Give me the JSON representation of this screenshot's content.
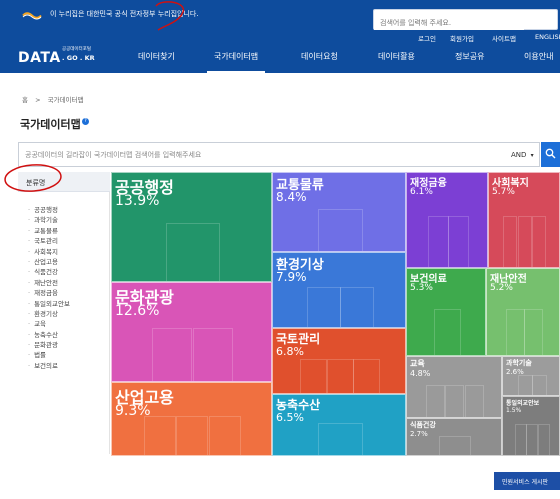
{
  "gov_banner": {
    "text": "이 누리집은 대한민국 공식 전자정부 누리집입니다."
  },
  "top_search": {
    "placeholder": "검색어를 입력해 주세요."
  },
  "util_links": [
    "로그인",
    "회원가입",
    "사이트맵",
    "ENGLISH"
  ],
  "brand": {
    "name": "DATA",
    "domain": ". GO . KR",
    "tagline": "공공데이터포털"
  },
  "nav": [
    "데이터찾기",
    "국가데이터맵",
    "데이터요청",
    "데이터활용",
    "정보공유",
    "이용안내"
  ],
  "breadcrumb": {
    "home": "홈",
    "separator": ">",
    "current": "국가데이터맵"
  },
  "page_title": "국가데이터맵",
  "map_search": {
    "placeholder": "공공데이터의 길라잡이 국가데이터맵 검색어를 입력해주세요",
    "operator": "AND"
  },
  "categories": {
    "header": "분류명",
    "items": [
      "공공행정",
      "과학기술",
      "교통물류",
      "국토관리",
      "사회복지",
      "산업고용",
      "식품건강",
      "재난안전",
      "재정금융",
      "통일외교안보",
      "환경기상",
      "교육",
      "농축수산",
      "문화관광",
      "법률",
      "보건의료"
    ]
  },
  "treemap": [
    {
      "name": "공공행정",
      "pct": "13.9%",
      "color": "#22956a"
    },
    {
      "name": "문화관광",
      "pct": "12.6%",
      "color": "#d955b7"
    },
    {
      "name": "산업고용",
      "pct": "9.3%",
      "color": "#f07040"
    },
    {
      "name": "교통물류",
      "pct": "8.4%",
      "color": "#6f6fe6"
    },
    {
      "name": "환경기상",
      "pct": "7.9%",
      "color": "#3a78d8"
    },
    {
      "name": "국토관리",
      "pct": "6.8%",
      "color": "#e0502d"
    },
    {
      "name": "농축수산",
      "pct": "6.5%",
      "color": "#20a1c5"
    },
    {
      "name": "재정금융",
      "pct": "6.1%",
      "color": "#7c3fd4"
    },
    {
      "name": "사회복지",
      "pct": "5.7%",
      "color": "#d64a5a"
    },
    {
      "name": "보건의료",
      "pct": "5.3%",
      "color": "#3eaa4d"
    },
    {
      "name": "재난안전",
      "pct": "5.2%",
      "color": "#76c06e"
    },
    {
      "name": "교육",
      "pct": "4.8%",
      "color": "#9a9a9a"
    },
    {
      "name": "식품건강",
      "pct": "2.7%",
      "color": "#8e8e8e"
    },
    {
      "name": "과학기술",
      "pct": "2.6%",
      "color": "#9c9c9c"
    },
    {
      "name": "통일외교안보",
      "pct": "1.5%",
      "color": "#7d7d7d"
    }
  ],
  "service_button": "민원서비스 게시판",
  "colors": {
    "header_blue": "#0e4c9d",
    "accent_blue": "#1d6fd8",
    "annotation_red": "#d01010"
  }
}
